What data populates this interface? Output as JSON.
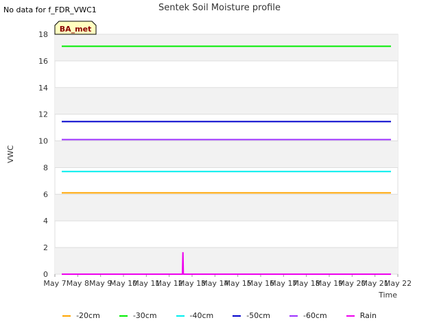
{
  "header": {
    "no_data_text": "No data for f_FDR_VWC1",
    "title": "Sentek Soil Moisture profile"
  },
  "badge": {
    "label": "BA_met",
    "bg": "#ffffc0",
    "text_color": "#8b0000"
  },
  "chart_data": {
    "type": "line",
    "title": "Sentek Soil Moisture profile",
    "xlabel": "Time",
    "ylabel": "VWC",
    "x_ticks": [
      "May 7",
      "May 8",
      "May 9",
      "May 10",
      "May 11",
      "May 12",
      "May 13",
      "May 14",
      "May 15",
      "May 16",
      "May 17",
      "May 18",
      "May 19",
      "May 20",
      "May 21",
      "May 22"
    ],
    "y_ticks": [
      0,
      2,
      4,
      6,
      8,
      10,
      12,
      14,
      16,
      18
    ],
    "xlim": [
      0,
      15
    ],
    "ylim": [
      0,
      18
    ],
    "grid": "alternating horizontal bands",
    "series": [
      {
        "name": "-20cm",
        "color": "#ffa500",
        "x": [
          0.3,
          14.7
        ],
        "y": [
          6.1,
          6.1
        ]
      },
      {
        "name": "-30cm",
        "color": "#00ee00",
        "x": [
          0.3,
          14.7
        ],
        "y": [
          17.1,
          17.1
        ]
      },
      {
        "name": "-40cm",
        "color": "#00eeee",
        "x": [
          0.3,
          14.7
        ],
        "y": [
          7.7,
          7.7
        ]
      },
      {
        "name": "-50cm",
        "color": "#0000cc",
        "x": [
          0.3,
          14.7
        ],
        "y": [
          11.45,
          11.45
        ]
      },
      {
        "name": "-60cm",
        "color": "#9b30ff",
        "x": [
          0.3,
          14.7
        ],
        "y": [
          10.1,
          10.1
        ]
      },
      {
        "name": "Rain",
        "color": "#ee00ee",
        "x": [
          0.3,
          5.58,
          5.6,
          5.62,
          5.64,
          14.7
        ],
        "y": [
          0,
          0,
          1.65,
          0,
          0,
          0
        ]
      }
    ]
  }
}
